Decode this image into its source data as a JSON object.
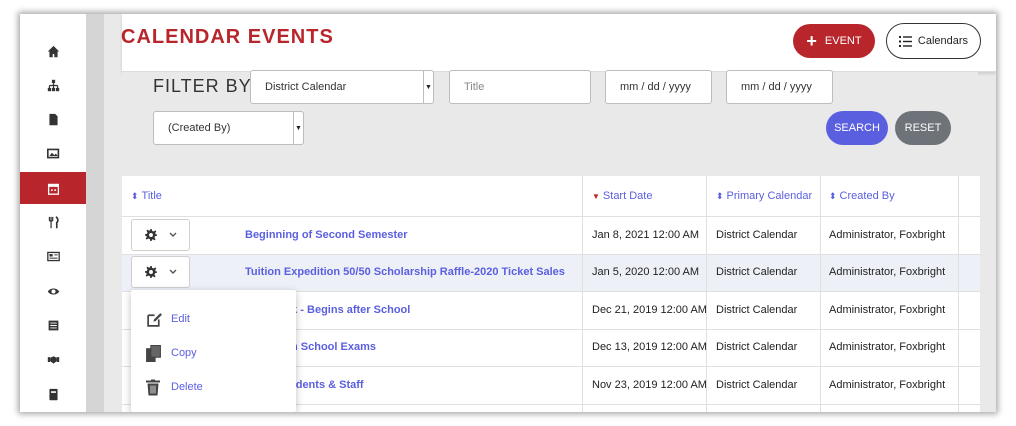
{
  "header": {
    "title": "CALENDAR EVENTS",
    "event_button": "EVENT",
    "calendars_button": "Calendars"
  },
  "filter": {
    "label": "FILTER BY:",
    "calendar_select": "District Calendar",
    "title_placeholder": "Title",
    "start_date_placeholder": "mm / dd / yyyy",
    "end_date_placeholder": "mm / dd / yyyy",
    "created_by_select": "(Created By)",
    "search_button": "SEARCH",
    "reset_button": "RESET"
  },
  "table": {
    "columns": [
      "Title",
      "Start Date",
      "Primary Calendar",
      "Created By"
    ],
    "rows": [
      {
        "title": "Beginning of Second Semester",
        "start": "Jan 8, 2021 12:00 AM",
        "calendar": "District Calendar",
        "created_by": "Administrator, Foxbright"
      },
      {
        "title": "Tuition Expedition 50/50 Scholarship Raffle-2020 Ticket Sales",
        "start": "Jan 5, 2020 12:00 AM",
        "calendar": "District Calendar",
        "created_by": "Administrator, Foxbright"
      },
      {
        "title": "ak - Begins after School",
        "start": "Dec 21, 2019 12:00 AM",
        "calendar": "District Calendar",
        "created_by": "Administrator, Foxbright"
      },
      {
        "title": "h School Exams",
        "start": "Dec 13, 2019 12:00 AM",
        "calendar": "District Calendar",
        "created_by": "Administrator, Foxbright"
      },
      {
        "title": "Students & Staff",
        "start": "Nov 23, 2019 12:00 AM",
        "calendar": "District Calendar",
        "created_by": "Administrator, Foxbright"
      }
    ]
  },
  "row_menu": {
    "edit": "Edit",
    "copy": "Copy",
    "delete": "Delete"
  },
  "sidebar": {
    "icons": [
      "home-icon",
      "sitemap-icon",
      "file-icon",
      "images-icon",
      "calendar-icon",
      "utensils-icon",
      "news-icon",
      "eye-icon",
      "list-icon",
      "handshake-icon",
      "book-icon"
    ],
    "active": "calendar-icon"
  },
  "colors": {
    "brand": "#b8262c",
    "link": "#5a5fe0",
    "reset": "#6d7378"
  }
}
